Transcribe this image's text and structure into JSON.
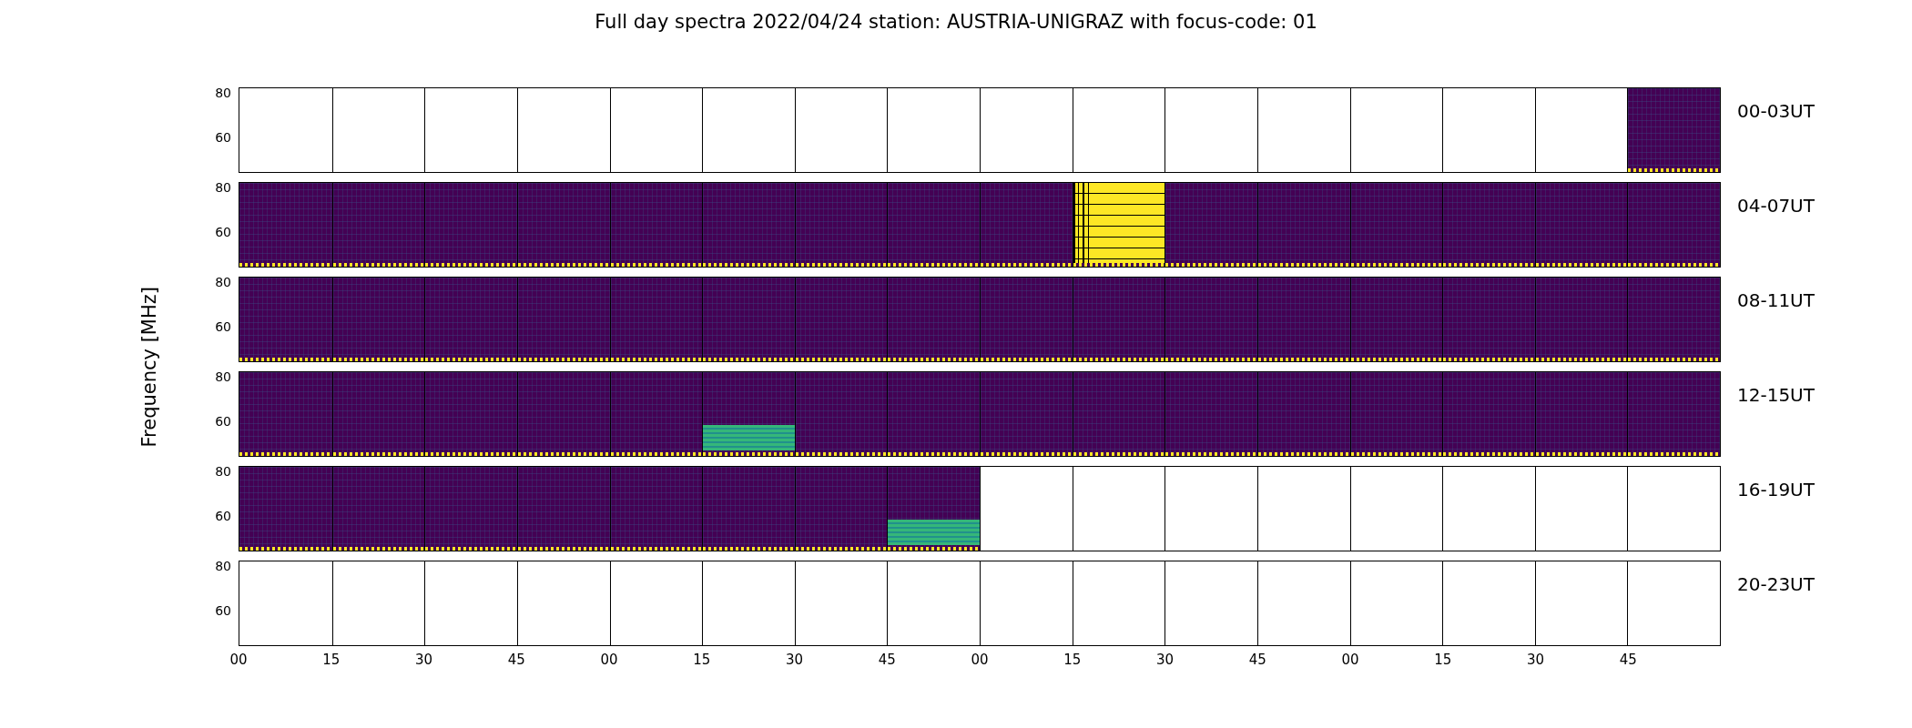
{
  "title": "Full day spectra 2022/04/24 station: AUSTRIA-UNIGRAZ with focus-code: 01",
  "ylabel": "Frequency [MHz]",
  "rows": [
    {
      "label": "00-03UT",
      "yticks": [
        "80",
        "60"
      ],
      "panels": [
        {
          "kind": "blank"
        },
        {
          "kind": "blank"
        },
        {
          "kind": "blank"
        },
        {
          "kind": "blank"
        },
        {
          "kind": "blank"
        },
        {
          "kind": "blank"
        },
        {
          "kind": "blank"
        },
        {
          "kind": "blank"
        },
        {
          "kind": "blank"
        },
        {
          "kind": "blank"
        },
        {
          "kind": "blank"
        },
        {
          "kind": "blank"
        },
        {
          "kind": "blank"
        },
        {
          "kind": "blank"
        },
        {
          "kind": "blank"
        },
        {
          "kind": "spectrum"
        }
      ]
    },
    {
      "label": "04-07UT",
      "yticks": [
        "80",
        "60"
      ],
      "panels": [
        {
          "kind": "spectrum"
        },
        {
          "kind": "spectrum"
        },
        {
          "kind": "spectrum"
        },
        {
          "kind": "spectrum"
        },
        {
          "kind": "spectrum"
        },
        {
          "kind": "spectrum"
        },
        {
          "kind": "spectrum"
        },
        {
          "kind": "spectrum"
        },
        {
          "kind": "spectrum"
        },
        {
          "kind": "burst"
        },
        {
          "kind": "spectrum"
        },
        {
          "kind": "spectrum"
        },
        {
          "kind": "spectrum"
        },
        {
          "kind": "spectrum"
        },
        {
          "kind": "spectrum"
        },
        {
          "kind": "spectrum"
        }
      ]
    },
    {
      "label": "08-11UT",
      "yticks": [
        "80",
        "60"
      ],
      "panels": [
        {
          "kind": "spectrum"
        },
        {
          "kind": "spectrum"
        },
        {
          "kind": "spectrum"
        },
        {
          "kind": "spectrum"
        },
        {
          "kind": "spectrum"
        },
        {
          "kind": "spectrum"
        },
        {
          "kind": "spectrum"
        },
        {
          "kind": "spectrum"
        },
        {
          "kind": "spectrum"
        },
        {
          "kind": "spectrum"
        },
        {
          "kind": "spectrum"
        },
        {
          "kind": "spectrum"
        },
        {
          "kind": "spectrum"
        },
        {
          "kind": "spectrum"
        },
        {
          "kind": "spectrum"
        },
        {
          "kind": "spectrum"
        }
      ]
    },
    {
      "label": "12-15UT",
      "yticks": [
        "80",
        "60"
      ],
      "panels": [
        {
          "kind": "spectrum"
        },
        {
          "kind": "spectrum"
        },
        {
          "kind": "spectrum"
        },
        {
          "kind": "spectrum"
        },
        {
          "kind": "spectrum"
        },
        {
          "kind": "band"
        },
        {
          "kind": "spectrum"
        },
        {
          "kind": "spectrum"
        },
        {
          "kind": "spectrum"
        },
        {
          "kind": "spectrum"
        },
        {
          "kind": "spectrum"
        },
        {
          "kind": "spectrum"
        },
        {
          "kind": "spectrum"
        },
        {
          "kind": "spectrum"
        },
        {
          "kind": "spectrum"
        },
        {
          "kind": "spectrum"
        }
      ]
    },
    {
      "label": "16-19UT",
      "yticks": [
        "80",
        "60"
      ],
      "panels": [
        {
          "kind": "spectrum"
        },
        {
          "kind": "spectrum"
        },
        {
          "kind": "spectrum"
        },
        {
          "kind": "spectrum"
        },
        {
          "kind": "spectrum"
        },
        {
          "kind": "spectrum"
        },
        {
          "kind": "spectrum"
        },
        {
          "kind": "band"
        },
        {
          "kind": "blank"
        },
        {
          "kind": "blank"
        },
        {
          "kind": "blank"
        },
        {
          "kind": "blank"
        },
        {
          "kind": "blank"
        },
        {
          "kind": "blank"
        },
        {
          "kind": "blank"
        },
        {
          "kind": "blank"
        }
      ]
    },
    {
      "label": "20-23UT",
      "yticks": [
        "80",
        "60"
      ],
      "panels": [
        {
          "kind": "blank"
        },
        {
          "kind": "blank"
        },
        {
          "kind": "blank"
        },
        {
          "kind": "blank"
        },
        {
          "kind": "blank"
        },
        {
          "kind": "blank"
        },
        {
          "kind": "blank"
        },
        {
          "kind": "blank"
        },
        {
          "kind": "blank"
        },
        {
          "kind": "blank"
        },
        {
          "kind": "blank"
        },
        {
          "kind": "blank"
        },
        {
          "kind": "blank"
        },
        {
          "kind": "blank"
        },
        {
          "kind": "blank"
        },
        {
          "kind": "blank"
        }
      ]
    }
  ],
  "xticks": [
    "00",
    "15",
    "30",
    "45",
    "00",
    "15",
    "30",
    "45",
    "00",
    "15",
    "30",
    "45",
    "00",
    "15",
    "30",
    "45"
  ]
}
